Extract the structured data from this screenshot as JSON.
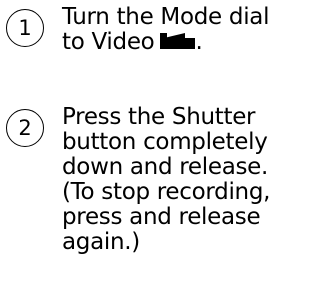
{
  "steps": [
    {
      "number": "1",
      "lines": [
        "Turn the Mode dial",
        "to Video"
      ],
      "suffix": ".",
      "icon": "video-camera-icon"
    },
    {
      "number": "2",
      "lines": [
        "Press the Shutter",
        "button completely",
        "down and release.",
        "(To stop recording,",
        "press and release",
        "again.)"
      ]
    }
  ],
  "colors": {
    "text": "#000000",
    "background": "#ffffff"
  }
}
